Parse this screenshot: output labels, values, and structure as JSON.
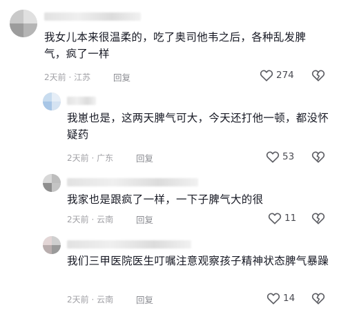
{
  "comments": [
    {
      "text": "我女儿本来很温柔的，吃了奥司他韦之后，各种乱发脾气，疯了一样",
      "meta": "2天前 · 江苏",
      "reply_label": "回复",
      "likes": "274",
      "icons": {
        "like": "heart-outline-icon",
        "dislike": "broken-heart-icon"
      }
    },
    {
      "text": "我崽也是，这两天脾气可大，今天还打他一顿，都没怀疑药",
      "meta": "2天前 · 广东",
      "reply_label": "回复",
      "likes": "53",
      "icons": {
        "like": "heart-outline-icon",
        "dislike": "broken-heart-icon"
      }
    },
    {
      "text": "我家也是跟疯了一样，一下子脾气大的很",
      "meta": "2天前 · 云南",
      "reply_label": "回复",
      "likes": "11",
      "icons": {
        "like": "heart-outline-icon",
        "dislike": "broken-heart-icon"
      }
    },
    {
      "text": "我们三甲医院医生叮嘱注意观察孩子精神状态脾气暴躁",
      "meta": "2天前 · 云南",
      "reply_label": "回复",
      "likes": "14",
      "icons": {
        "like": "heart-outline-icon",
        "dislike": "broken-heart-icon"
      }
    }
  ],
  "colors": {
    "text": "#161823",
    "meta": "#a1a1a6",
    "reply": "#8a8b91",
    "icon": "#5c5d63"
  }
}
